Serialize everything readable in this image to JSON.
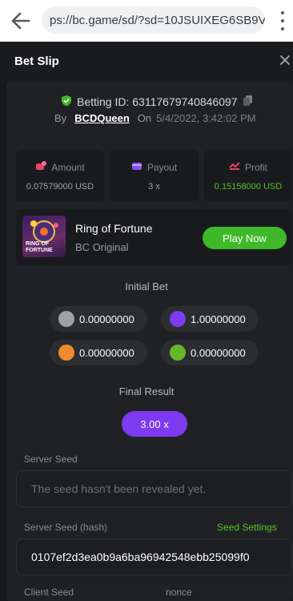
{
  "browser": {
    "url": "ps://bc.game/sd/?sd=10JSUIXEG6SB9V"
  },
  "modal": {
    "title": "Bet Slip"
  },
  "bet": {
    "id_label": "Betting ID: 63117679740846097",
    "by_label": "By",
    "user": "BCDQueen",
    "on_label": "On",
    "timestamp": "5/4/2022, 3:42:02 PM"
  },
  "stats": {
    "amount": {
      "label": "Amount",
      "value": "0.07579000 USD"
    },
    "payout": {
      "label": "Payout",
      "value": "3 x"
    },
    "profit": {
      "label": "Profit",
      "value": "0.15158000 USD"
    }
  },
  "game": {
    "name": "Ring of Fortune",
    "provider": "BC Original",
    "play_label": "Play Now",
    "thumb_text_1": "RING OF",
    "thumb_text_2": "FORTUNE"
  },
  "initial_bet": {
    "title": "Initial Bet",
    "items": [
      {
        "color": "#9ea1a7",
        "value": "0.00000000"
      },
      {
        "color": "#7b3cf2",
        "value": "1.00000000"
      },
      {
        "color": "#f3892f",
        "value": "0.00000000"
      },
      {
        "color": "#66b82a",
        "value": "0.00000000"
      }
    ]
  },
  "final_result": {
    "title": "Final Result",
    "value": "3.00 x"
  },
  "seeds": {
    "server_seed_label": "Server Seed",
    "server_seed_value": "The seed hasn't been revealed yet.",
    "server_hash_label": "Server Seed (hash)",
    "seed_settings_label": "Seed Settings",
    "server_hash_value": "0107ef2d3ea0b9a6ba96942548ebb25099f0",
    "client_seed_label": "Client Seed",
    "nonce_label": "nonce"
  },
  "colors": {
    "accent_green": "#3fb82a",
    "accent_purple": "#7c3bf0"
  }
}
